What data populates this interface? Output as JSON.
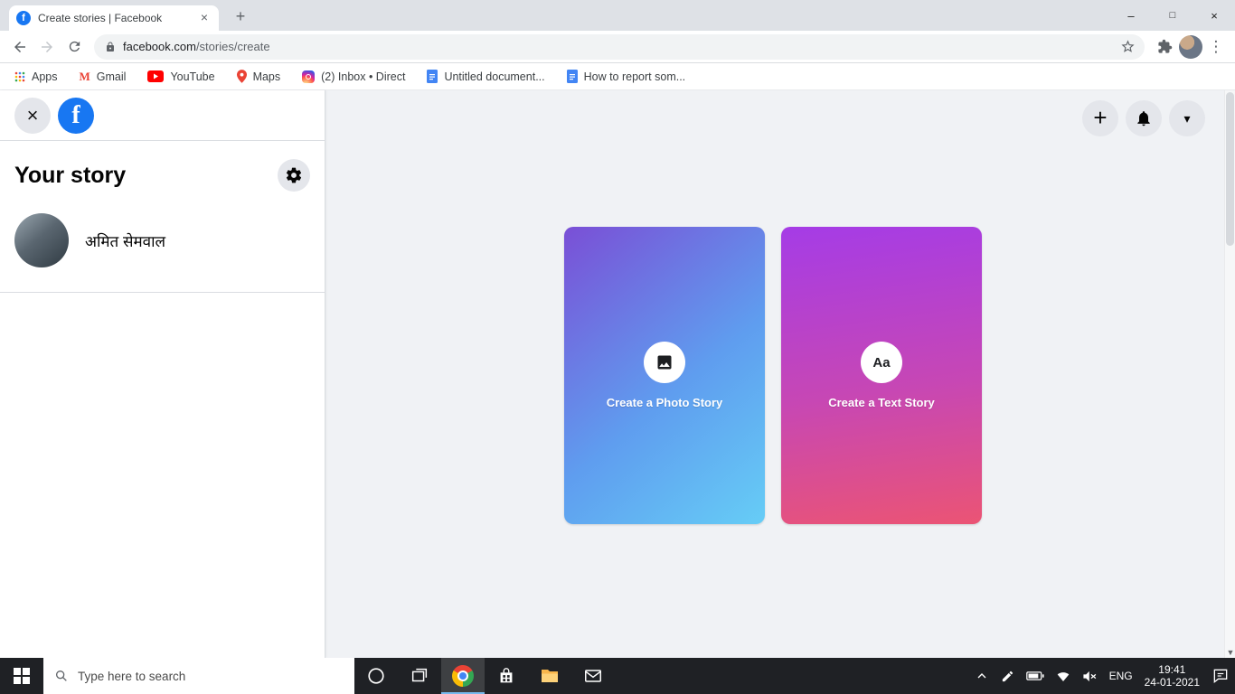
{
  "browser": {
    "tab_title": "Create stories | Facebook",
    "url_domain": "facebook.com",
    "url_path": "/stories/create",
    "bookmarks": [
      "Apps",
      "Gmail",
      "YouTube",
      "Maps",
      "(2) Inbox • Direct",
      "Untitled document...",
      "How to report som..."
    ]
  },
  "icons": {
    "facebook_f": "f",
    "tab_close": "×",
    "new_tab": "+",
    "minimize": "–",
    "maximize": "□",
    "window_close": "×",
    "menu_dots": "⋮",
    "gmail_m": "M",
    "sidebar_close": "×",
    "plus": "+",
    "chevron_down": "▾",
    "text_story": "Aa",
    "scroll_down": "▼"
  },
  "sidebar": {
    "title": "Your story",
    "user_name": "अमित सेमवाल"
  },
  "main": {
    "cards": [
      {
        "label": "Create a Photo Story"
      },
      {
        "label": "Create a Text Story"
      }
    ]
  },
  "taskbar": {
    "search_placeholder": "Type here to search",
    "language": "ENG",
    "time": "19:41",
    "date": "24-01-2021"
  },
  "colors": {
    "facebook_blue": "#1877f2",
    "page_background": "#f0f2f5",
    "photo_story_gradient": [
      "#7a4fd6",
      "#66cdf6"
    ],
    "text_story_gradient": [
      "#a53ce6",
      "#eb5474"
    ],
    "taskbar_background": "#1f2125"
  }
}
